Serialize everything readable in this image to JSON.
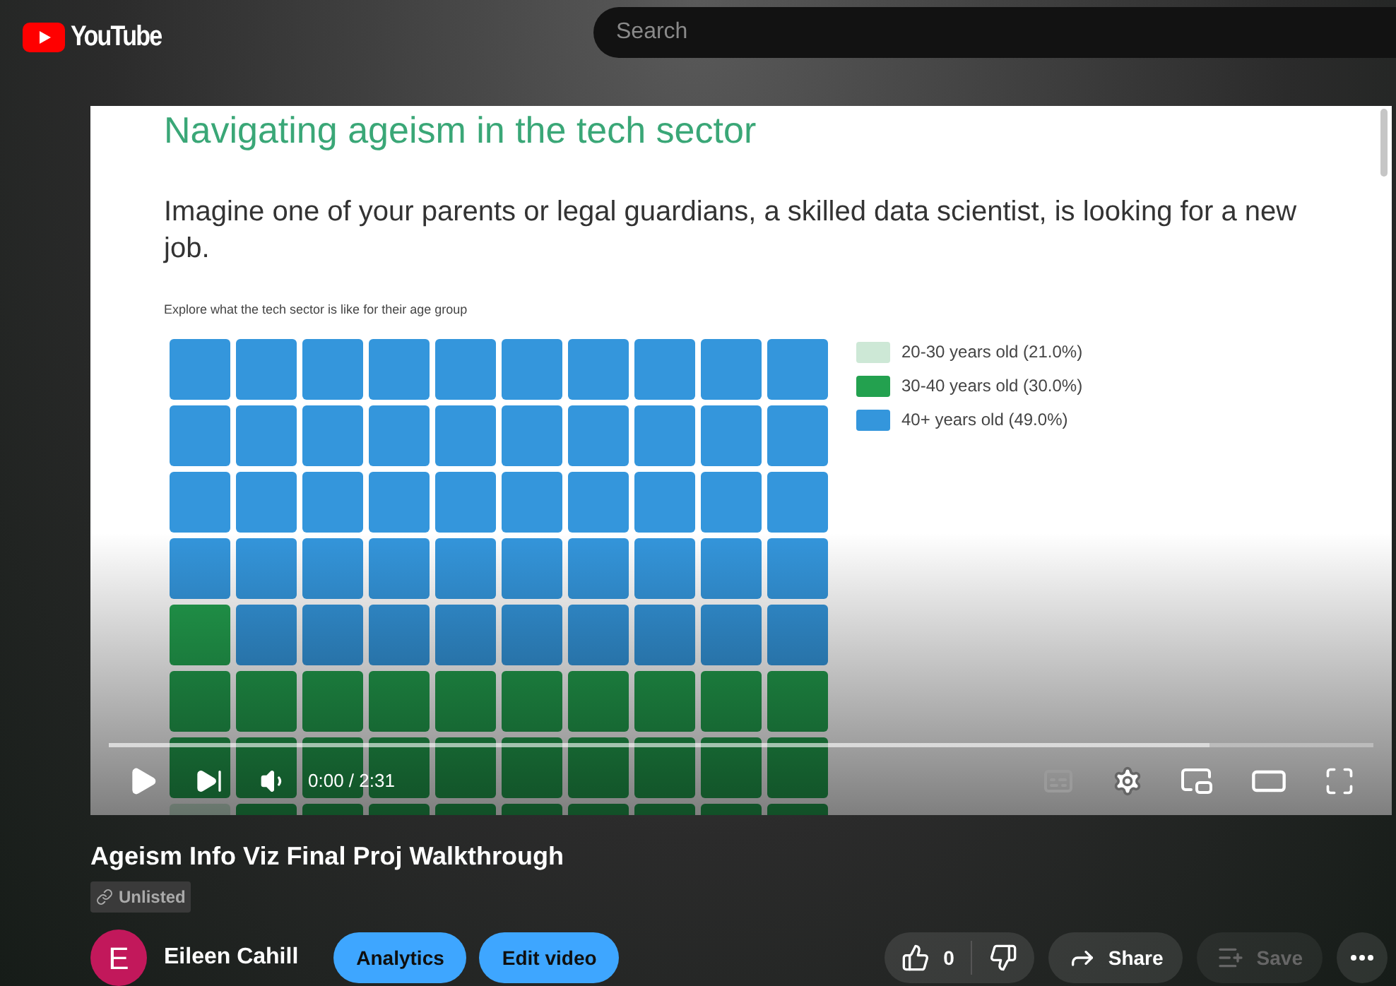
{
  "header": {
    "logo": "YouTube",
    "search": {
      "placeholder": "Search"
    }
  },
  "slide": {
    "title": "Navigating ageism in the tech sector",
    "question": "Imagine one of your parents or legal guardians, a skilled data scientist, is looking for a new job.",
    "caption": "Explore what the tech sector is like for their age group",
    "legend": [
      {
        "label": "20-30 years old (21.0%)",
        "color": "#cde8d6",
        "kind": "young"
      },
      {
        "label": "30-40 years old (30.0%)",
        "color": "#23a14f",
        "kind": "mid"
      },
      {
        "label": "40+ years old (49.0%)",
        "color": "#3496dc",
        "kind": "senior"
      }
    ],
    "waffle_rows": [
      {
        "cells": [
          {
            "kind": "senior"
          },
          {
            "kind": "senior"
          },
          {
            "kind": "senior"
          },
          {
            "kind": "senior"
          },
          {
            "kind": "senior"
          },
          {
            "kind": "senior"
          },
          {
            "kind": "senior"
          },
          {
            "kind": "senior"
          },
          {
            "kind": "senior"
          },
          {
            "kind": "senior"
          }
        ]
      },
      {
        "cells": [
          {
            "kind": "senior"
          },
          {
            "kind": "senior"
          },
          {
            "kind": "senior"
          },
          {
            "kind": "senior"
          },
          {
            "kind": "senior"
          },
          {
            "kind": "senior"
          },
          {
            "kind": "senior"
          },
          {
            "kind": "senior"
          },
          {
            "kind": "senior"
          },
          {
            "kind": "senior"
          }
        ]
      },
      {
        "cells": [
          {
            "kind": "senior"
          },
          {
            "kind": "senior"
          },
          {
            "kind": "senior"
          },
          {
            "kind": "senior"
          },
          {
            "kind": "senior"
          },
          {
            "kind": "senior"
          },
          {
            "kind": "senior"
          },
          {
            "kind": "senior"
          },
          {
            "kind": "senior"
          },
          {
            "kind": "senior"
          }
        ]
      },
      {
        "cells": [
          {
            "kind": "senior"
          },
          {
            "kind": "senior"
          },
          {
            "kind": "senior"
          },
          {
            "kind": "senior"
          },
          {
            "kind": "senior"
          },
          {
            "kind": "senior"
          },
          {
            "kind": "senior"
          },
          {
            "kind": "senior"
          },
          {
            "kind": "senior"
          },
          {
            "kind": "senior"
          }
        ]
      },
      {
        "cells": [
          {
            "kind": "mid"
          },
          {
            "kind": "senior"
          },
          {
            "kind": "senior"
          },
          {
            "kind": "senior"
          },
          {
            "kind": "senior"
          },
          {
            "kind": "senior"
          },
          {
            "kind": "senior"
          },
          {
            "kind": "senior"
          },
          {
            "kind": "senior"
          },
          {
            "kind": "senior"
          }
        ]
      },
      {
        "cells": [
          {
            "kind": "mid"
          },
          {
            "kind": "mid"
          },
          {
            "kind": "mid"
          },
          {
            "kind": "mid"
          },
          {
            "kind": "mid"
          },
          {
            "kind": "mid"
          },
          {
            "kind": "mid"
          },
          {
            "kind": "mid"
          },
          {
            "kind": "mid"
          },
          {
            "kind": "mid"
          }
        ]
      },
      {
        "cells": [
          {
            "kind": "mid"
          },
          {
            "kind": "mid"
          },
          {
            "kind": "mid"
          },
          {
            "kind": "mid"
          },
          {
            "kind": "mid"
          },
          {
            "kind": "mid"
          },
          {
            "kind": "mid"
          },
          {
            "kind": "mid"
          },
          {
            "kind": "mid"
          },
          {
            "kind": "mid"
          }
        ]
      },
      {
        "cells": [
          {
            "kind": "young"
          },
          {
            "kind": "mid"
          },
          {
            "kind": "mid"
          },
          {
            "kind": "mid"
          },
          {
            "kind": "mid"
          },
          {
            "kind": "mid"
          },
          {
            "kind": "mid"
          },
          {
            "kind": "mid"
          },
          {
            "kind": "mid"
          },
          {
            "kind": "mid"
          }
        ]
      }
    ]
  },
  "player": {
    "time": "0:00 / 2:31",
    "playing": false,
    "buffered": {
      "level": 0.87
    }
  },
  "video": {
    "title": "Ageism Info Viz Final Proj Walkthrough",
    "visibility": "Unlisted"
  },
  "channel": {
    "avatar_letter": "E",
    "name": "Eileen Cahill"
  },
  "buttons": [
    {
      "label": "Analytics"
    },
    {
      "label": "Edit video"
    }
  ],
  "actions": {
    "likes": "0",
    "share": "Share",
    "save": {
      "label": "Save",
      "disabled": true
    }
  }
}
